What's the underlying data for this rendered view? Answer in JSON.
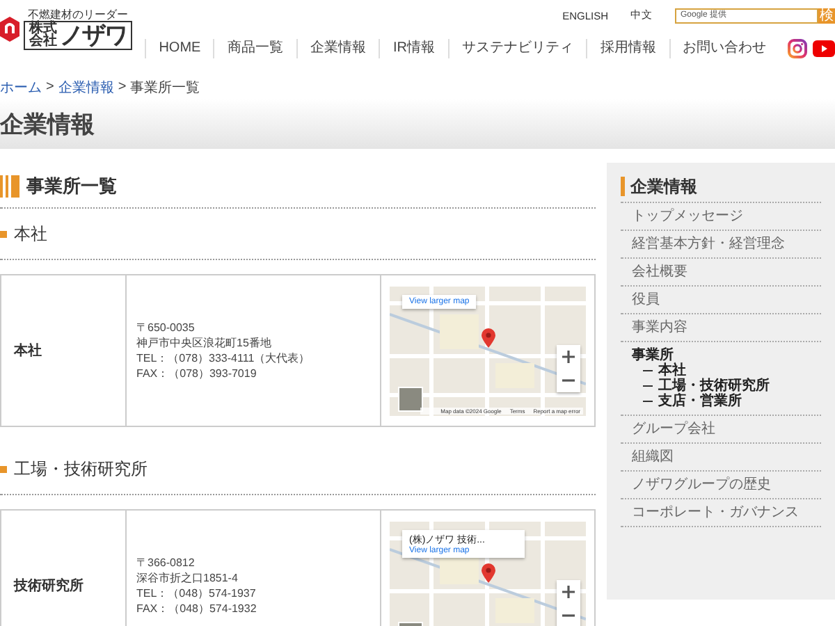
{
  "header": {
    "logo": {
      "tagline": "不燃建材のリーダー",
      "company_type": "株式会社",
      "name": "ノザワ"
    },
    "language_links": [
      "ENGLISH",
      "中文"
    ],
    "search": {
      "placeholder": "Google 提供",
      "button": "検"
    },
    "nav": [
      "HOME",
      "商品一覧",
      "企業情報",
      "IR情報",
      "サステナビリティ",
      "採用情報",
      "お問い合わせ"
    ]
  },
  "breadcrumb": {
    "separator": ">",
    "items": [
      {
        "label": "ホーム",
        "link": true
      },
      {
        "label": "企業情報",
        "link": true
      },
      {
        "label": "事業所一覧",
        "link": false
      }
    ]
  },
  "page_title": "企業情報",
  "main": {
    "heading": "事業所一覧",
    "sections": [
      {
        "heading": "本社",
        "offices": [
          {
            "name": "本社",
            "address_lines": [
              "〒650-0035",
              "神戸市中央区浪花町15番地",
              "TEL：（078）333-4111（大代表）",
              "FAX：（078）393-7019"
            ],
            "map": {
              "link": "View larger map",
              "credits": [
                "Map data ©2024 Google",
                "Terms",
                "Report a map error"
              ]
            }
          }
        ]
      },
      {
        "heading": "工場・技術研究所",
        "offices": [
          {
            "name": "技術研究所",
            "address_lines": [
              "〒366-0812",
              "深谷市折之口1851-4",
              "TEL：（048）574-1937",
              "FAX：（048）574-1932"
            ],
            "map": {
              "place_name": "(株)ノザワ 技術...",
              "link": "View larger map"
            }
          }
        ]
      }
    ]
  },
  "sidebar": {
    "title": "企業情報",
    "items": [
      {
        "label": "トップメッセージ",
        "selected": false
      },
      {
        "label": "経営基本方針・経営理念",
        "selected": false
      },
      {
        "label": "会社概要",
        "selected": false
      },
      {
        "label": "役員",
        "selected": false
      },
      {
        "label": "事業内容",
        "selected": false
      },
      {
        "label": "事業所",
        "selected": true,
        "children": [
          {
            "label": "本社",
            "selected": false
          },
          {
            "label": "工場・技術研究所",
            "selected": false
          },
          {
            "label": "支店・営業所",
            "selected": false
          }
        ]
      },
      {
        "label": "グループ会社",
        "selected": false
      },
      {
        "label": "組織図",
        "selected": false
      },
      {
        "label": "ノザワグループの歴史",
        "selected": false
      },
      {
        "label": "コーポレート・ガバナンス",
        "selected": false
      }
    ]
  }
}
